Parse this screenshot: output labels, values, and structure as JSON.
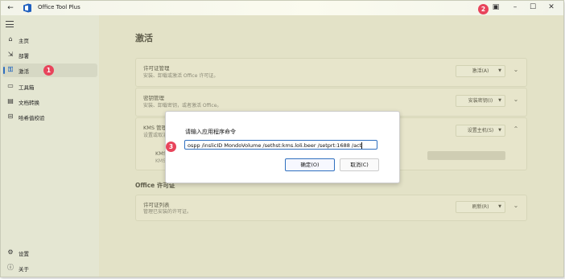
{
  "titlebar": {
    "back_icon": "back-arrow-icon",
    "app_icon": "office-logo-icon",
    "title": "Office Tool Plus",
    "controls": [
      "restore",
      "minimize",
      "maximize",
      "close"
    ]
  },
  "sidebar": {
    "menu_icon": "hamburger-icon",
    "items": [
      {
        "label": "主页",
        "icon": "home-icon",
        "active": false
      },
      {
        "label": "部署",
        "icon": "deploy-icon",
        "active": false
      },
      {
        "label": "激活",
        "icon": "key-icon",
        "active": true
      },
      {
        "label": "工具箱",
        "icon": "toolbox-icon",
        "active": false
      },
      {
        "label": "文档转换",
        "icon": "document-convert-icon",
        "active": false
      },
      {
        "label": "哈希值校验",
        "icon": "hash-check-icon",
        "active": false
      }
    ],
    "bottom_items": [
      {
        "label": "设置",
        "icon": "settings-icon"
      },
      {
        "label": "关于",
        "icon": "info-icon"
      }
    ]
  },
  "main": {
    "page_title": "激活",
    "cards": [
      {
        "title": "许可证管理",
        "subtitle": "安装、卸载或激活 Office 许可证。",
        "button": "激活(A)"
      },
      {
        "title": "密钥管理",
        "subtitle": "安装、卸载密钥，或者激活 Office。",
        "button": "安装密钥(I)"
      },
      {
        "title": "KMS 管理",
        "subtitle": "设置或取消",
        "button": "设置主机(S)"
      }
    ],
    "kms_sub_title": "KMS",
    "kms_sub_subtitle": "KMS",
    "section_title": "Office 许可证",
    "license_card": {
      "title": "许可证列表",
      "subtitle": "管理已安装的许可证。",
      "button": "刷新(R)"
    }
  },
  "dialog": {
    "title": "请输入应用程序命令",
    "input_value": "ospp /inslicID MondoVolume /sethst:kms.loli.beer /setprt:1688 /act",
    "ok_label": "确定(O)",
    "cancel_label": "取消(C)"
  },
  "markers": [
    "1",
    "2",
    "3"
  ],
  "colors": {
    "accent": "#2f6fbf",
    "marker": "#e8445b",
    "background": "#eef0e2"
  }
}
